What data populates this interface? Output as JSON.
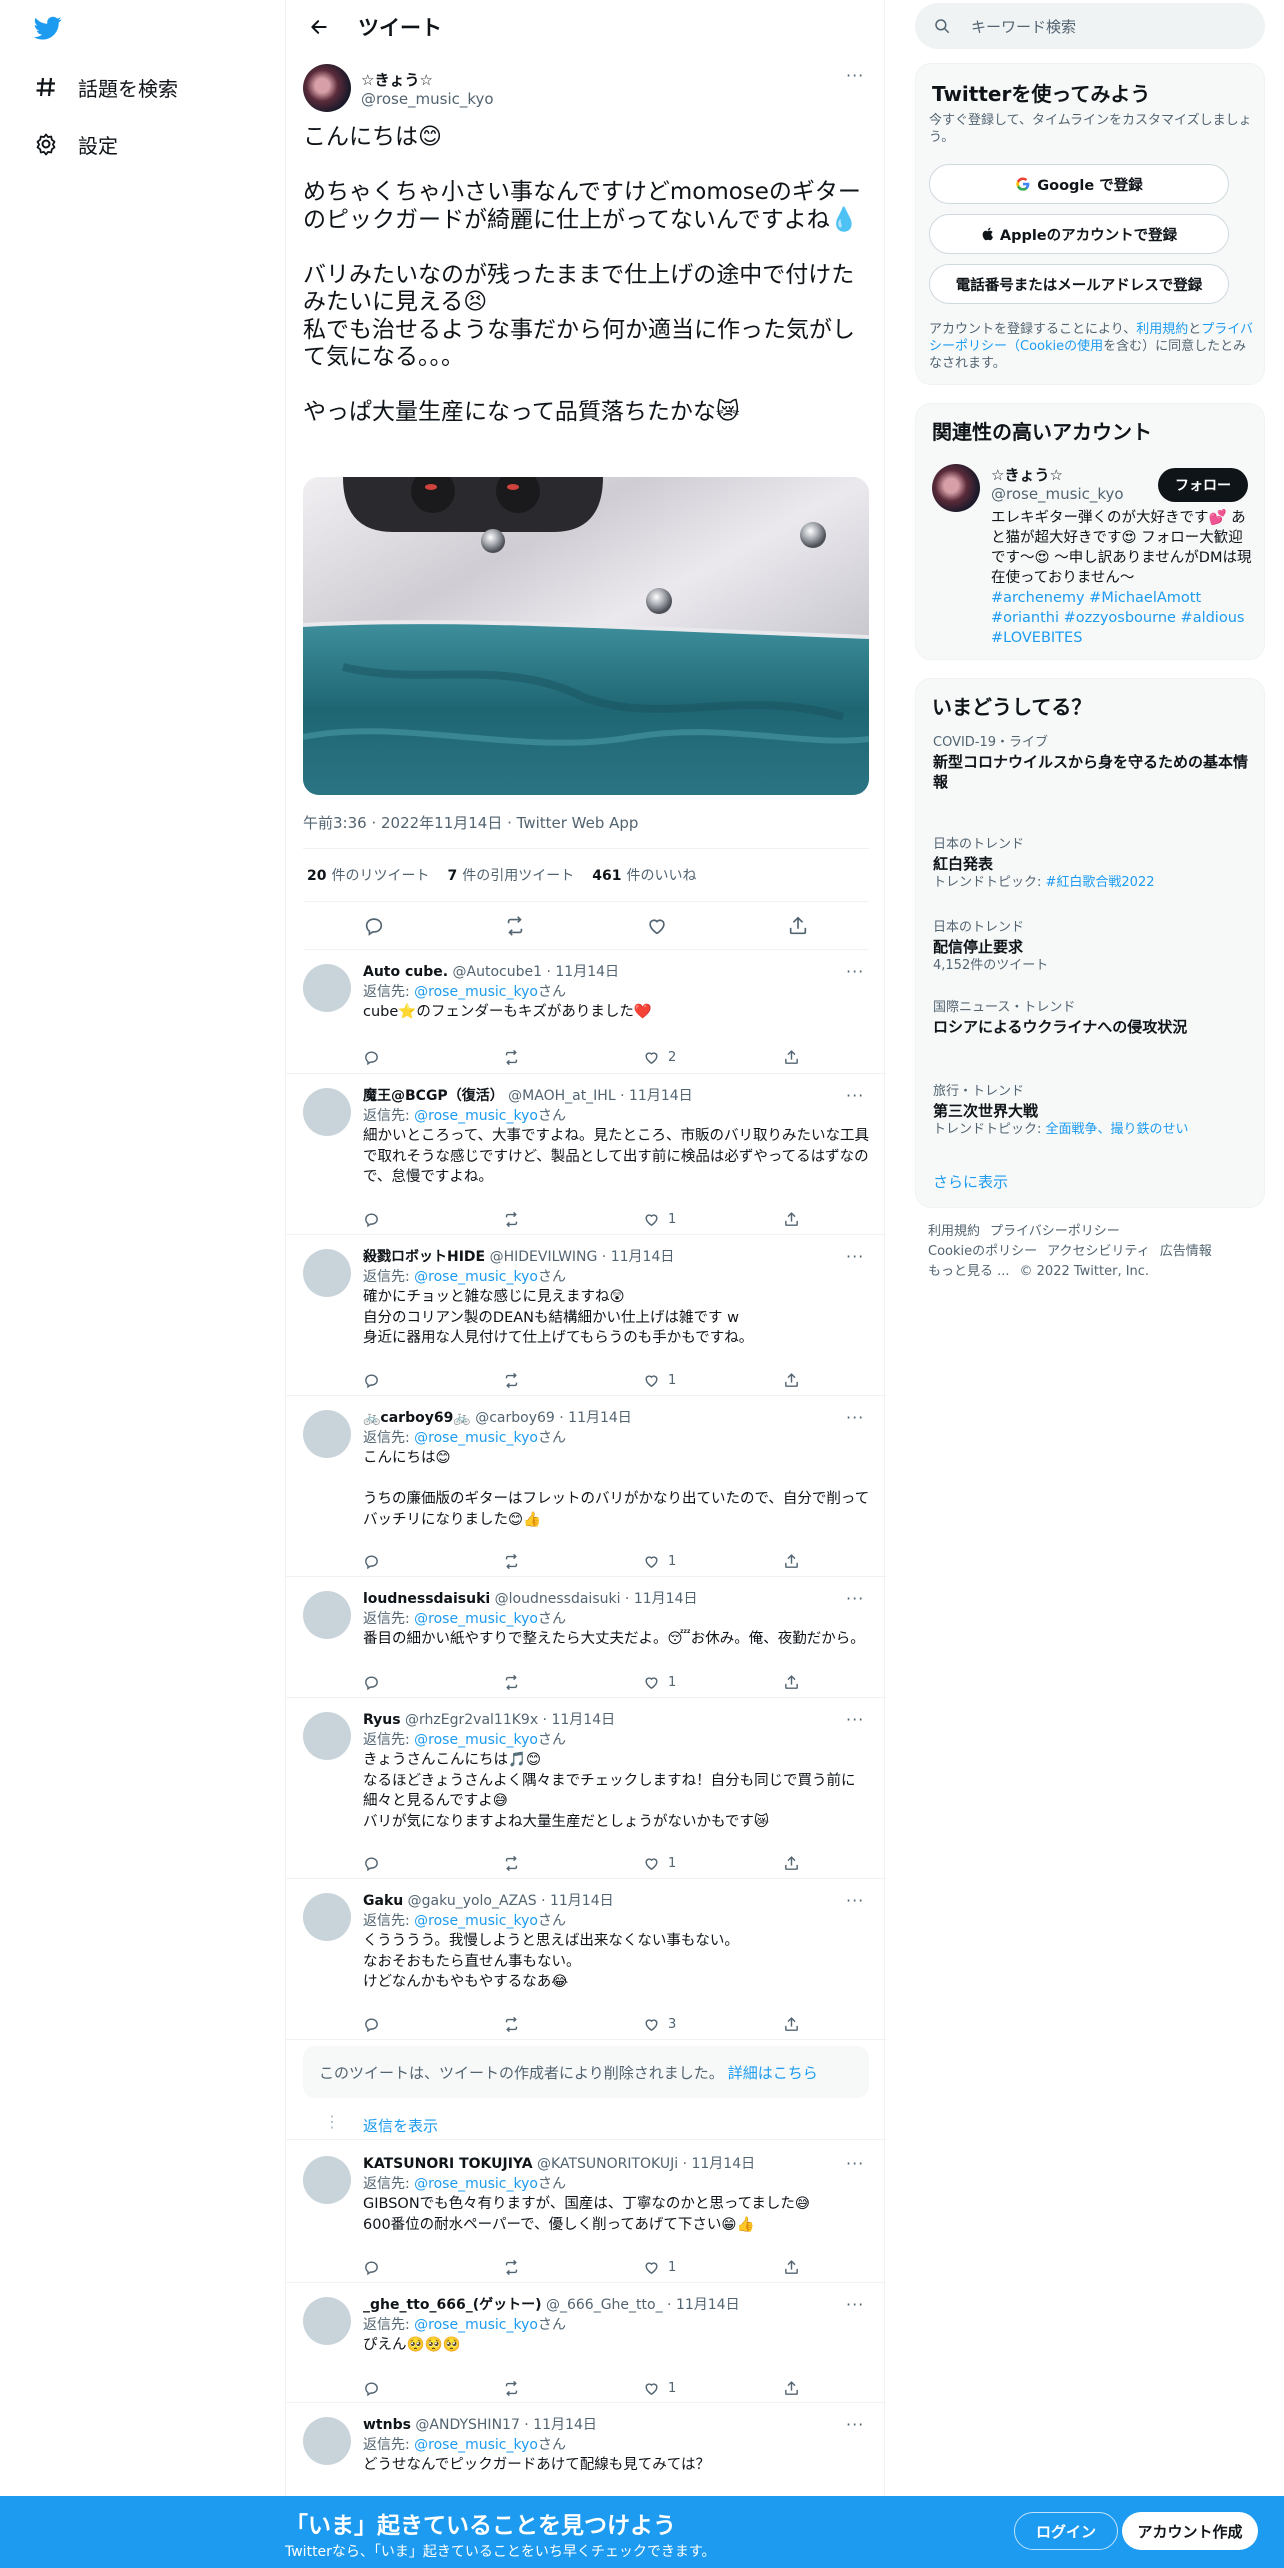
{
  "nav": {
    "logo_icon": "twitter-bird-icon",
    "explore": "話題を検索",
    "settings": "設定"
  },
  "header": {
    "title": "ツイート"
  },
  "tweet": {
    "name": "☆きょう☆",
    "handle": "@rose_music_kyo",
    "text": "こんにちは😊\n\nめちゃくちゃ小さい事なんですけどmomoseのギターのピックガードが綺麗に仕上がってないんですよね💧\n\nバリみたいなのが残ったままで仕上げの途中で付けたみたいに見える😣\n私でも治せるような事だから何か適当に作った気がして気になる。。。\n\nやっぱ大量生産になって品質落ちたかな😿",
    "meta": "午前3:36 · 2022年11月14日 · Twitter Web App",
    "retweets": "20",
    "retweets_label": "件のリツイート",
    "quotes": "7",
    "quotes_label": "件の引用ツイート",
    "likes": "461",
    "likes_label": "件のいいね"
  },
  "reply_prefix": "返信先: ",
  "reply_target": "@rose_music_kyo",
  "reply_suffix": "さん",
  "replies": [
    {
      "name": "Auto cube.",
      "handle": "@Autocube1",
      "date": "11月14日",
      "text": "cube⭐のフェンダーもキズがありました❤️",
      "likes": "2"
    },
    {
      "name": "魔王@BCGP（復活）",
      "handle": "@MAOH_at_IHL",
      "date": "11月14日",
      "text": "細かいところって、大事ですよね。見たところ、市販のバリ取りみたいな工具で取れそうな感じですけど、製品として出す前に検品は必ずやってるはずなので、怠慢ですよね。",
      "likes": "1"
    },
    {
      "name": "殺戮ロボットHIDE",
      "handle": "@HIDEVILWING",
      "date": "11月14日",
      "text": "確かにチョッと雑な感じに見えますね😲\n自分のコリアン製のDEANも結構細かい仕上げは雑です w\n身近に器用な人見付けて仕上げてもらうのも手かもですね。",
      "likes": "1"
    },
    {
      "name": "🚲carboy69🚲",
      "handle": "@carboy69",
      "date": "11月14日",
      "text": "こんにちは😊\n\nうちの廉価版のギターはフレットのバリがかなり出ていたので、自分で削ってバッチリになりました😊👍",
      "likes": "1"
    },
    {
      "name": "loudnessdaisuki",
      "handle": "@loudnessdaisuki",
      "date": "11月14日",
      "text": "番目の細かい紙やすりで整えたら大丈夫だよ。😴お休み。俺、夜勤だから。",
      "likes": "1"
    },
    {
      "name": "Ryus",
      "handle": "@rhzEgr2val11K9x",
      "date": "11月14日",
      "text": "きょうさんこんにちは🎵😊\nなるほどきょうさんよく隅々までチェックしますね！自分も同じで買う前に細々と見るんですよ😅\nバリが気になりますよね大量生産だとしょうがないかもです😿",
      "likes": "1"
    },
    {
      "name": "Gaku",
      "handle": "@gaku_yolo_AZAS",
      "date": "11月14日",
      "text": "くうううう。我慢しようと思えば出来なくない事もない。\nなおそおもたら直せん事もない。\nけどなんかもやもやするなあ😂",
      "likes": "3"
    },
    {
      "name": "KATSUNORI TOKUJIYA",
      "handle": "@KATSUNORITOKUJi",
      "date": "11月14日",
      "text": "GIBSONでも色々有りますが、国産は、丁寧なのかと思ってました😅\n600番位の耐水ペーパーで、優しく削ってあげて下さい😁👍",
      "likes": "1"
    },
    {
      "name": "_ghe_tto_666_(ゲットー)",
      "handle": "@_666_Ghe_tto_",
      "date": "11月14日",
      "text": "ぴえん🥺🥺🥺",
      "likes": "1"
    },
    {
      "name": "wtnbs",
      "handle": "@ANDYSHIN17",
      "date": "11月14日",
      "text": "どうせなんでピックガードあけて配線も見てみては？",
      "likes": ""
    }
  ],
  "deleted_notice": "このツイートは、ツイートの作成者により削除されました。",
  "deleted_link": "詳細はこちら",
  "show_replies": "返信を表示",
  "sidebar": {
    "search_placeholder": "キーワード検索",
    "signup": {
      "title": "Twitterを使ってみよう",
      "subtitle": "今すぐ登録して、タイムラインをカスタマイズしましょう。",
      "google": "Google で登録",
      "apple": "Appleのアカウントで登録",
      "phone": "電話番号またはメールアドレスで登録",
      "legal_1": "アカウントを登録することにより、",
      "legal_terms": "利用規約",
      "legal_2": "と",
      "legal_privacy": "プライバシーポリシー（Cookieの使用",
      "legal_3": "を含む）に同意したとみなされます。"
    },
    "related": {
      "title": "関連性の高いアカウント",
      "name": "☆きょう☆",
      "handle": "@rose_music_kyo",
      "follow": "フォロー",
      "bio": "エレキギター弾くのが大好きです💕 あと猫が超大好きです😍 フォロー大歓迎です～😍 ～申し訳ありませんがDMは現在使っておりません～",
      "tags": "#archenemy #MichaelAmott #orianthi #ozzyosbourne #aldious #LOVEBITES"
    },
    "trends": {
      "title": "いまどうしてる？",
      "items": [
        {
          "context": "COVID-19・ライブ",
          "title": "新型コロナウイルスから身を守るための基本情報",
          "sub": ""
        },
        {
          "context": "日本のトレンド",
          "title": "紅白発表",
          "sub_label": "トレンドトピック: ",
          "sub_link": "#紅白歌合戦2022"
        },
        {
          "context": "日本のトレンド",
          "title": "配信停止要求",
          "sub": "4,152件のツイート"
        },
        {
          "context": "国際ニュース・トレンド",
          "title": "ロシアによるウクライナへの侵攻状況",
          "sub": ""
        },
        {
          "context": "旅行・トレンド",
          "title": "第三次世界大戦",
          "sub_label": "トレンドトピック: ",
          "sub_link": "全面戦争、撮り鉄のせい"
        }
      ],
      "more": "さらに表示"
    },
    "footer": {
      "terms": "利用規約",
      "privacy": "プライバシーポリシー",
      "cookie": "Cookieのポリシー",
      "accessibility": "アクセシビリティ",
      "ads": "広告情報",
      "more": "もっと見る ...",
      "copyright": "© 2022 Twitter, Inc."
    }
  },
  "banner": {
    "title": "「いま」起きていることを見つけよう",
    "subtitle": "Twitterなら、「いま」起きていることをいち早くチェックできます。",
    "login": "ログイン",
    "signup": "アカウント作成"
  },
  "colors": {
    "accent": "#1d9bf0",
    "text": "#0f1419",
    "muted": "#536471",
    "like": "#f91880"
  }
}
